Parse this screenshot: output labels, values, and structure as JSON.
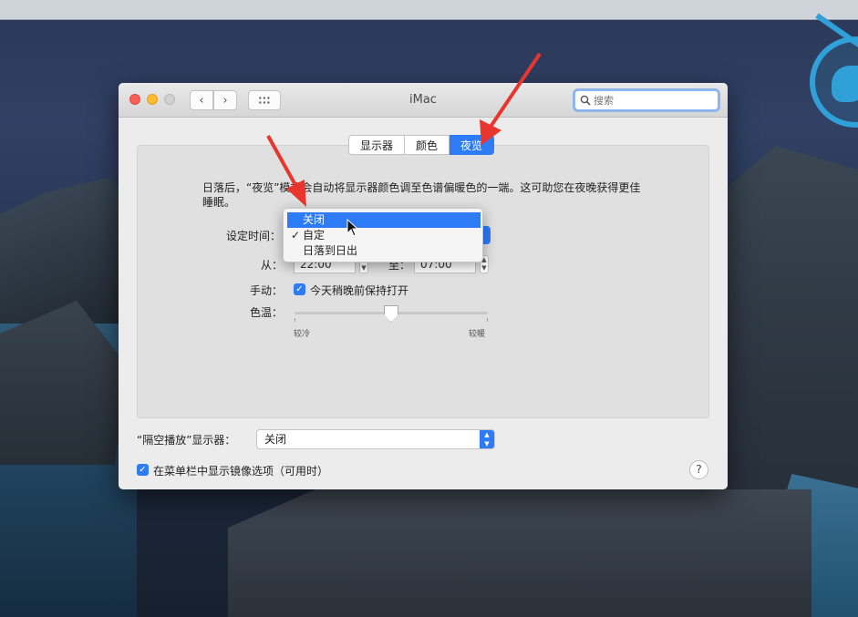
{
  "window": {
    "title": "iMac"
  },
  "search": {
    "placeholder": "搜索"
  },
  "tabs": [
    {
      "label": "显示器",
      "active": false
    },
    {
      "label": "颜色",
      "active": false
    },
    {
      "label": "夜览",
      "active": true
    }
  ],
  "night_shift": {
    "description": "日落后，“夜览”模式会自动将显示器颜色调至色谱偏暖色的一端。这可助您在夜晚获得更佳睡眠。",
    "schedule_label": "设定时间：",
    "schedule_menu": {
      "items": [
        {
          "label": "关闭",
          "highlighted": true,
          "checked": false
        },
        {
          "label": "自定",
          "highlighted": false,
          "checked": true
        },
        {
          "label": "日落到日出",
          "highlighted": false,
          "checked": false
        }
      ],
      "check_mark": "✓"
    },
    "from_label": "从：",
    "from_time": "22:00",
    "to_label": "至：",
    "to_time": "07:00",
    "manual_label": "手动：",
    "manual_checkbox_label": "今天稍晚前保持打开",
    "manual_checked": true,
    "temperature_label": "色温：",
    "temperature_less": "较冷",
    "temperature_more": "较暖",
    "temperature_value": 0.5
  },
  "airplay": {
    "label": "“隔空播放”显示器：",
    "selected": "关闭"
  },
  "mirroring": {
    "label": "在菜单栏中显示镜像选项（可用时）",
    "checked": true
  },
  "help": {
    "label": "?"
  },
  "colors": {
    "accent": "#2d7cf6",
    "annotation": "#e8352e"
  }
}
